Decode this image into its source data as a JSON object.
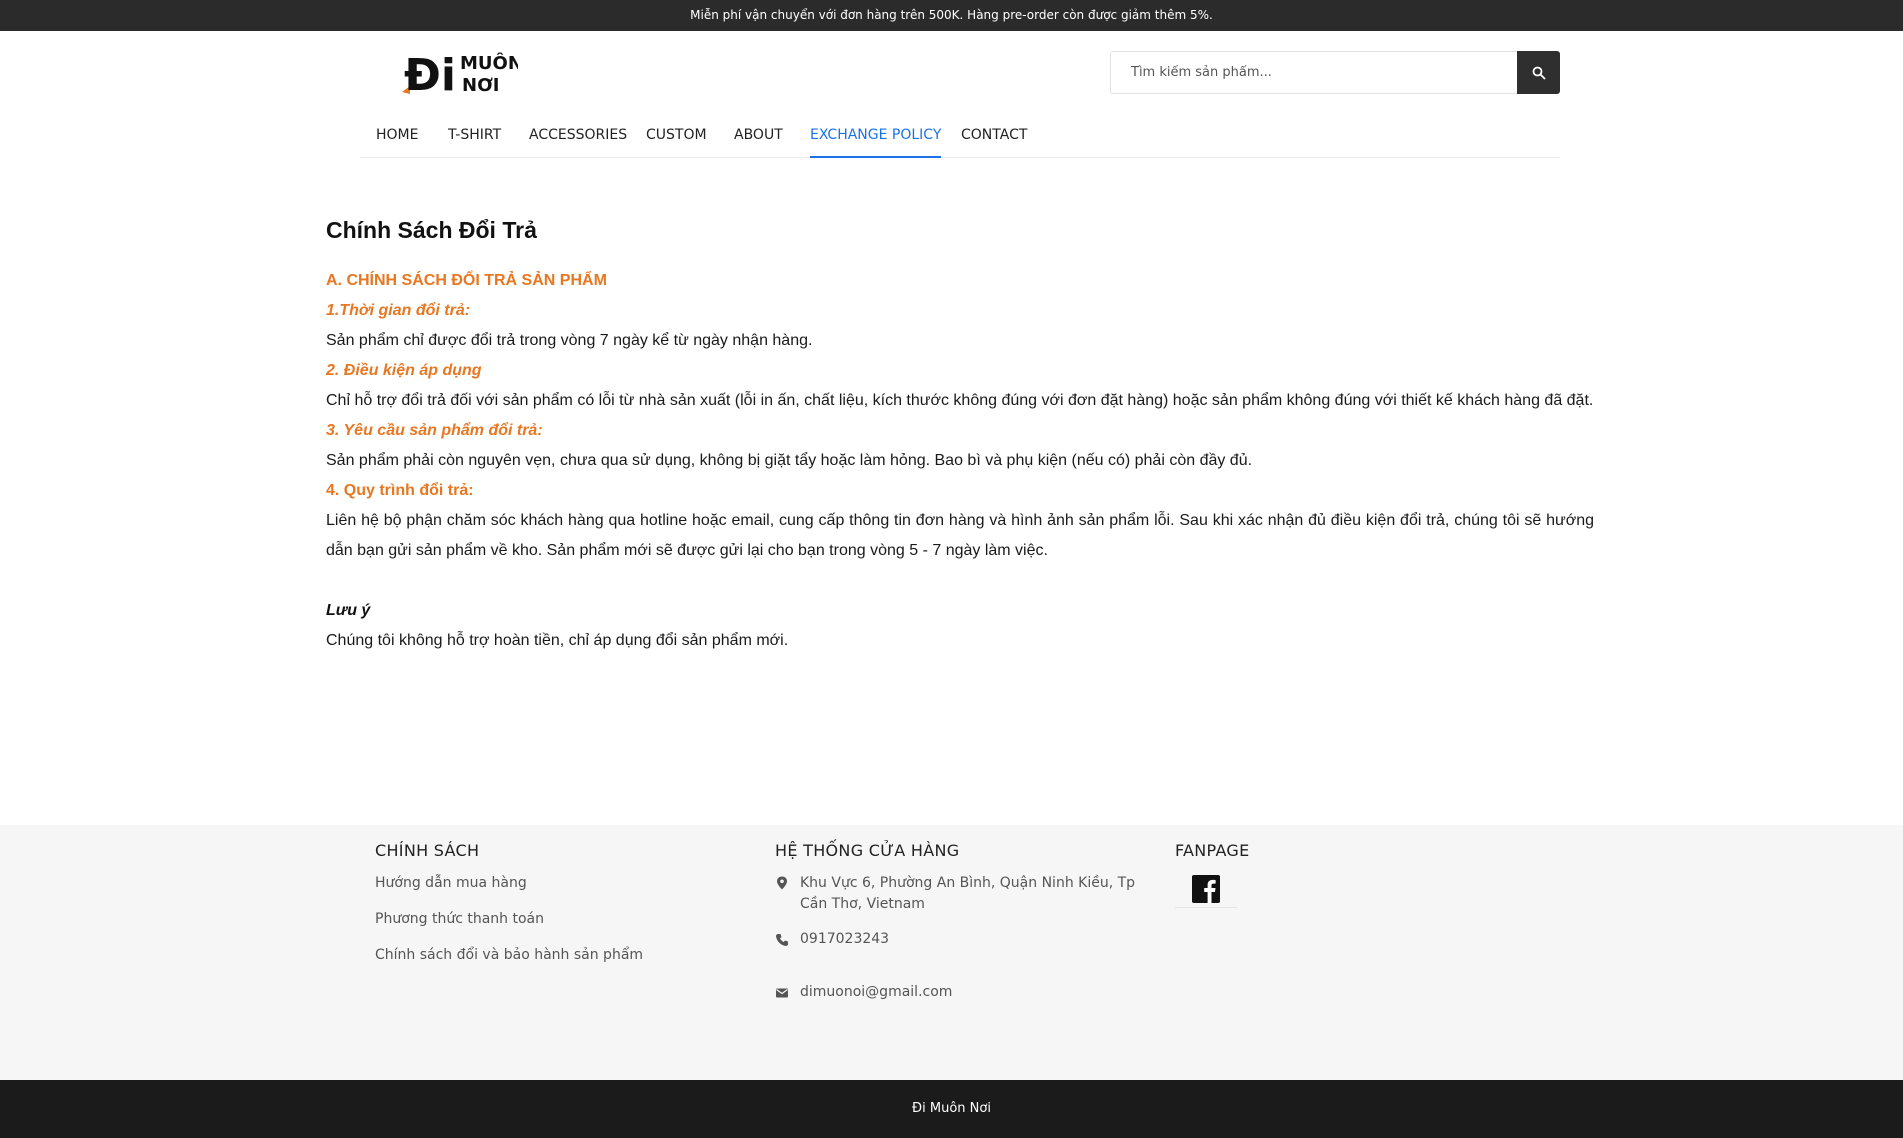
{
  "announcement": "Miễn phí vận chuyển với đơn hàng trên 500K. Hàng pre-order còn được giảm thêm 5%.",
  "logo": {
    "line1": "Đi",
    "line2": "MUÔN",
    "line3": "NƠI"
  },
  "search": {
    "placeholder": "Tìm kiếm sản phẩm..."
  },
  "nav": {
    "items": [
      {
        "label": "HOME",
        "active": false
      },
      {
        "label": "T-SHIRT",
        "active": false
      },
      {
        "label": "ACCESSORIES",
        "active": false
      },
      {
        "label": "CUSTOM",
        "active": false
      },
      {
        "label": "ABOUT",
        "active": false
      },
      {
        "label": "EXCHANGE POLICY",
        "active": true
      },
      {
        "label": "CONTACT",
        "active": false
      }
    ]
  },
  "page": {
    "title": "Chính Sách Đổi Trả",
    "section_a": "A. CHÍNH SÁCH ĐỔI TRẢ SẢN PHẨM",
    "h1": "1.Thời gian đổi trả:",
    "p1": "Sản phẩm chỉ được đổi trả trong vòng 7 ngày kể từ ngày nhận hàng.",
    "h2": "2. Điều kiện áp dụng",
    "p2": "Chỉ hỗ trợ đổi trả đối với sản phẩm có lỗi từ nhà sản xuất (lỗi in ấn, chất liệu, kích thước không đúng với đơn đặt hàng) hoặc sản phẩm không đúng với thiết kế khách hàng đã đặt.",
    "h3": "3. Yêu cầu sản phẩm đổi trả:",
    "p3": "Sản phẩm phải còn nguyên vẹn, chưa qua sử dụng, không bị giặt tẩy hoặc làm hỏng. Bao bì và phụ kiện (nếu có) phải còn đầy đủ.",
    "h4": "4. Quy trình đổi trả:",
    "p4": "Liên hệ bộ phận chăm sóc khách hàng qua hotline hoặc email, cung cấp thông tin đơn hàng và hình ảnh sản phẩm lỗi. Sau khi xác nhận đủ điều kiện đổi trả, chúng tôi sẽ hướng dẫn bạn gửi sản phẩm về kho. Sản phẩm mới sẽ được gửi lại cho bạn trong vòng 5 - 7 ngày làm việc.",
    "note_title": "Lưu ý",
    "note_text": "Chúng tôi không hỗ trợ hoàn tiền, chỉ áp dụng đổi sản phẩm mới."
  },
  "footer": {
    "policy_heading": "CHÍNH SÁCH",
    "policy_links": [
      "Hướng dẫn mua hàng",
      "Phương thức thanh toán",
      "Chính sách đổi và bảo hành sản phẩm"
    ],
    "stores_heading": "HỆ THỐNG CỬA HÀNG",
    "address": "Khu Vực 6, Phường An Bình, Quận Ninh Kiều, Tp Cần Thơ, Vietnam",
    "phone": "0917023243",
    "email": "dimuonoi@gmail.com",
    "fanpage_heading": "FANPAGE",
    "copyright": "Đi Muôn Nơi"
  },
  "colors": {
    "accent_orange": "#e87722",
    "active_nav": "#1a73e8",
    "dark_bar": "#2b2b2b",
    "footer_bg": "#f6f6f6"
  },
  "icons": [
    "search-icon",
    "location-pin-icon",
    "phone-icon",
    "mail-icon",
    "facebook-icon"
  ]
}
